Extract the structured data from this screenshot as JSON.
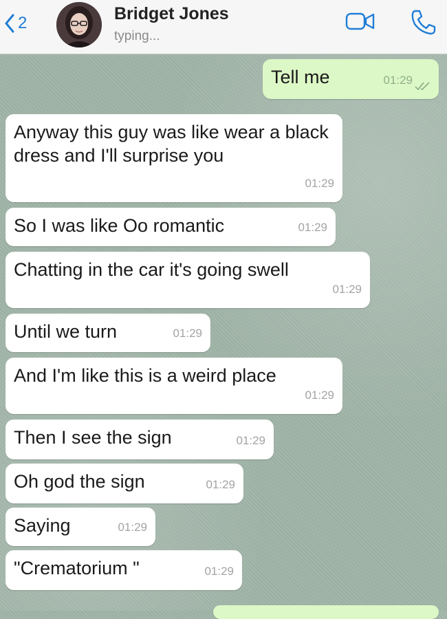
{
  "header": {
    "back_count": "2",
    "contact_name": "Bridget Jones",
    "status": "typing...",
    "icons": [
      "chevron-left-icon",
      "video-camera-icon",
      "phone-icon"
    ],
    "accent_color": "#1f7dd6"
  },
  "messages": [
    {
      "direction": "outgoing",
      "text": "Tell me",
      "time": "01:29",
      "status_icon": "double-check-icon"
    },
    {
      "direction": "incoming",
      "text": "Anyway this guy was like wear a black dress and I'll surprise you",
      "time": "01:29"
    },
    {
      "direction": "incoming",
      "text": "So I was like Oo romantic",
      "time": "01:29"
    },
    {
      "direction": "incoming",
      "text": "Chatting in the car it's going swell",
      "time": "01:29"
    },
    {
      "direction": "incoming",
      "text": "Until we turn",
      "time": "01:29"
    },
    {
      "direction": "incoming",
      "text": "And I'm like this is a weird place",
      "time": "01:29"
    },
    {
      "direction": "incoming",
      "text": "Then I see the sign",
      "time": "01:29"
    },
    {
      "direction": "incoming",
      "text": "Oh god the sign",
      "time": "01:29"
    },
    {
      "direction": "incoming",
      "text": "Saying",
      "time": "01:29"
    },
    {
      "direction": "incoming",
      "text": "\"Crematorium \"",
      "time": "01:29"
    }
  ],
  "colors": {
    "incoming_bubble": "#ffffff",
    "outgoing_bubble": "#dcf8c6",
    "timestamp": "#a3a3a3"
  }
}
